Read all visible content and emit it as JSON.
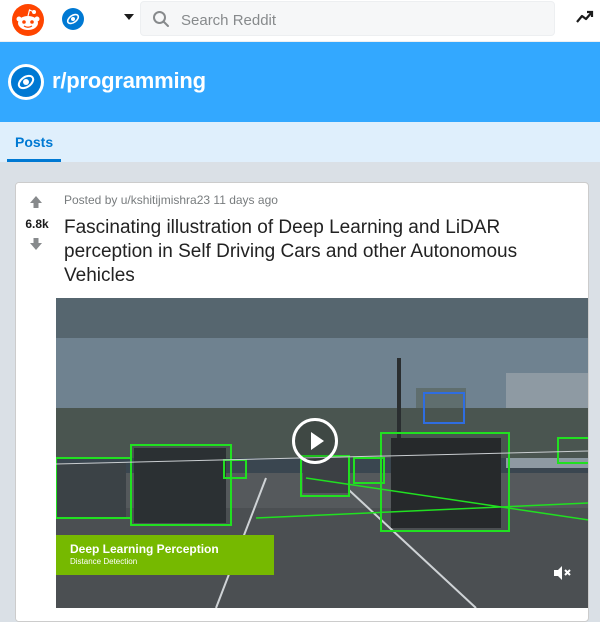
{
  "header": {
    "search_placeholder": "Search Reddit",
    "icons": [
      "reddit-logo-icon",
      "subreddit-icon",
      "chevron-down-icon",
      "search-icon",
      "trending-icon"
    ]
  },
  "banner": {
    "subreddit": "r/programming"
  },
  "tabs": {
    "posts": "Posts"
  },
  "post": {
    "score": "6.8k",
    "posted_by": "Posted by u/kshitijmishra23",
    "age": "11 days ago",
    "title": "Fascinating illustration of Deep Learning and LiDAR perception in Self Driving Cars and other Autonomous Vehicles",
    "video": {
      "caption_title": "Deep Learning Perception",
      "caption_subtitle": "Distance Detection"
    }
  },
  "colors": {
    "banner": "#33a8ff",
    "tabs_bg": "#dfeffc",
    "accent": "#0079d3",
    "reddit_orange": "#ff4500",
    "caption_green": "#76b900",
    "detection_green": "#21e021"
  }
}
